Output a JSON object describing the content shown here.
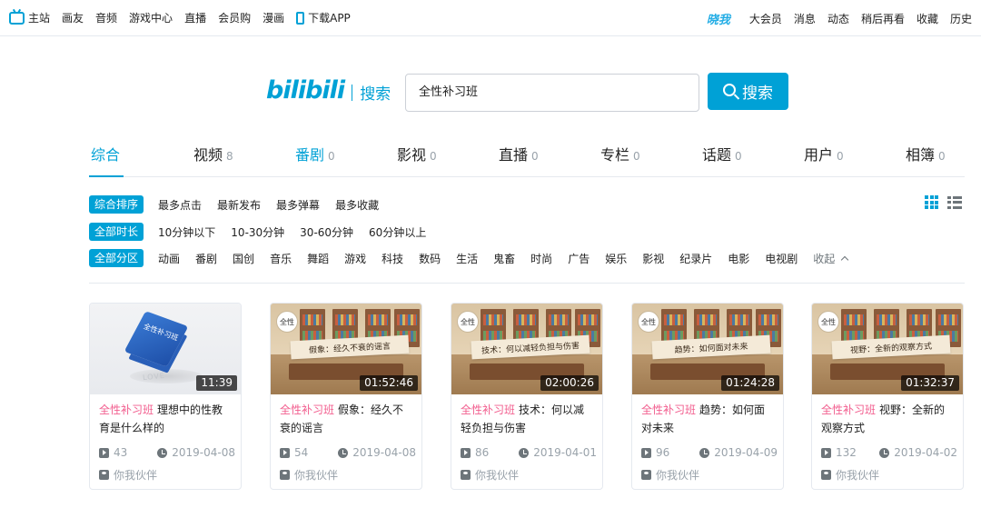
{
  "topnav": {
    "left": [
      {
        "label": "主站",
        "icon": "tv-icon"
      },
      {
        "label": "画友"
      },
      {
        "label": "音频"
      },
      {
        "label": "游戏中心"
      },
      {
        "label": "直播"
      },
      {
        "label": "会员购"
      },
      {
        "label": "漫画"
      },
      {
        "label": "下载APP",
        "icon": "phone-icon"
      }
    ],
    "logo_mini": "晓我",
    "right": [
      "大会员",
      "消息",
      "动态",
      "稍后再看",
      "收藏",
      "历史"
    ]
  },
  "brand": {
    "logo": "bilibili",
    "sub": "搜索"
  },
  "search": {
    "query": "全性补习班",
    "button": "搜索"
  },
  "tabs": [
    {
      "label": "综合",
      "count": ""
    },
    {
      "label": "视频",
      "count": "8"
    },
    {
      "label": "番剧",
      "count": "0"
    },
    {
      "label": "影视",
      "count": "0"
    },
    {
      "label": "直播",
      "count": "0"
    },
    {
      "label": "专栏",
      "count": "0"
    },
    {
      "label": "话题",
      "count": "0"
    },
    {
      "label": "用户",
      "count": "0"
    },
    {
      "label": "相簿",
      "count": "0"
    }
  ],
  "filters": {
    "sort": {
      "active": "综合排序",
      "options": [
        "最多点击",
        "最新发布",
        "最多弹幕",
        "最多收藏"
      ]
    },
    "duration": {
      "active": "全部时长",
      "options": [
        "10分钟以下",
        "10-30分钟",
        "30-60分钟",
        "60分钟以上"
      ]
    },
    "zone": {
      "active": "全部分区",
      "options": [
        "动画",
        "番剧",
        "国创",
        "音乐",
        "舞蹈",
        "游戏",
        "科技",
        "数码",
        "生活",
        "鬼畜",
        "时尚",
        "广告",
        "娱乐",
        "影视",
        "纪录片",
        "电影",
        "电视剧"
      ],
      "collapse": "收起"
    }
  },
  "colors": {
    "accent": "#00a1d6",
    "highlight": "#f25d8e"
  },
  "videos": [
    {
      "keyword": "全性补习班",
      "title": "理想中的性教育是什么样的",
      "duration": "11:39",
      "plays": "43",
      "date": "2019-04-08",
      "up": "你我伙伴",
      "thumb": "cube",
      "banner": "",
      "cube_label": "全性补习班",
      "love": "LOVE"
    },
    {
      "keyword": "全性补习班",
      "title": "假象：经久不衰的谣言",
      "duration": "01:52:46",
      "plays": "54",
      "date": "2019-04-08",
      "up": "你我伙伴",
      "thumb": "room",
      "banner": "假象：经久不衰的谣言",
      "stamp": "全性"
    },
    {
      "keyword": "全性补习班",
      "title": "技术：何以减轻负担与伤害",
      "duration": "02:00:26",
      "plays": "86",
      "date": "2019-04-01",
      "up": "你我伙伴",
      "thumb": "room",
      "banner": "技术：何以减轻负担与伤害",
      "stamp": "全性"
    },
    {
      "keyword": "全性补习班",
      "title": "趋势：如何面对未来",
      "duration": "01:24:28",
      "plays": "96",
      "date": "2019-04-09",
      "up": "你我伙伴",
      "thumb": "room",
      "banner": "趋势：如何面对未来",
      "stamp": "全性"
    },
    {
      "keyword": "全性补习班",
      "title": "视野：全新的观察方式",
      "duration": "01:32:37",
      "plays": "132",
      "date": "2019-04-02",
      "up": "你我伙伴",
      "thumb": "room",
      "banner": "视野：全新的观察方式",
      "stamp": "全性"
    }
  ]
}
